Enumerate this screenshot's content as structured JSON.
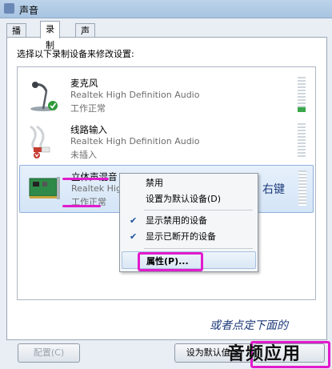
{
  "window": {
    "title": "声音"
  },
  "tabs": [
    {
      "label": "播放"
    },
    {
      "label": "录制"
    },
    {
      "label": "声音"
    }
  ],
  "instruction": "选择以下录制设备来修改设置:",
  "devices": [
    {
      "name": "麦克风",
      "driver": "Realtek High Definition Audio",
      "status": "工作正常"
    },
    {
      "name": "线路输入",
      "driver": "Realtek High Definition Audio",
      "status": "未插入"
    },
    {
      "name": "立体声混音",
      "driver": "Realtek High",
      "status": "工作正常"
    }
  ],
  "context_menu": {
    "items": [
      {
        "label": "禁用"
      },
      {
        "label": "设置为默认设备(D)"
      },
      {
        "label": "显示禁用的设备",
        "checked": true
      },
      {
        "label": "显示已断开的设备",
        "checked": true
      },
      {
        "label": "属性(P)..."
      }
    ]
  },
  "annotations": {
    "right_click": "右键",
    "bottom_note": "或者点定下面的",
    "big_note": "音频应用"
  },
  "buttons": {
    "configure": "配置(C)",
    "set_default": "设为默认值(S)"
  },
  "colors": {
    "highlight": "#e21bcc",
    "selection": "#d4e5f7"
  }
}
